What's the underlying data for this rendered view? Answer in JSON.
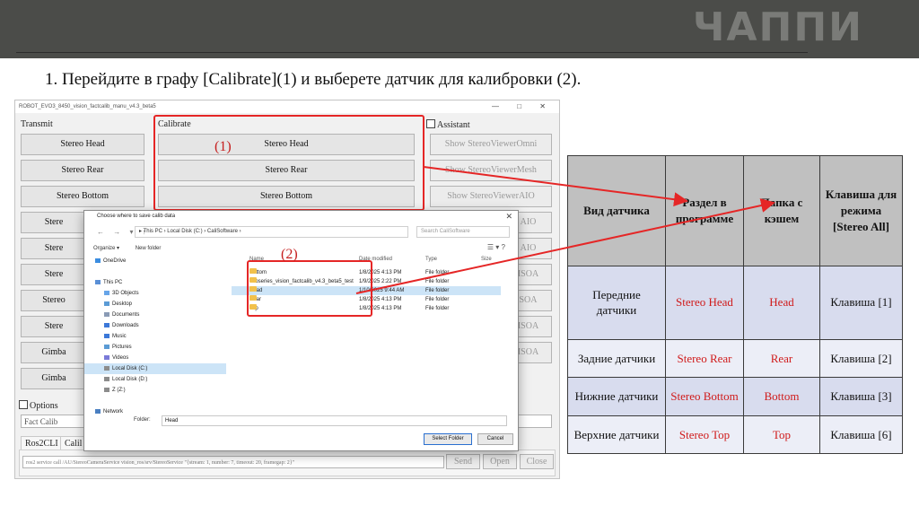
{
  "brand": {
    "logo_text": "ЧАППИ"
  },
  "instruction": "1.  Перейдите в графу [Calibrate](1) и выберете датчик для калибровки (2).",
  "markers": {
    "m1": "(1)",
    "m2": "(2)"
  },
  "app": {
    "window_title": "ROBOT_EVO3_8450_vision_factcalib_manu_v4.3_beta5",
    "window_controls": "— □ ✕",
    "sections": {
      "transmit": "Transmit",
      "calibrate": "Calibrate",
      "assistant": "Assistant",
      "options": "Options"
    },
    "transmit_buttons": [
      "Stereo Head",
      "Stereo Rear",
      "Stereo Bottom",
      "Stere",
      "Stere",
      "Stere",
      "Stereo",
      "Stere",
      "Gimba",
      "Gimba"
    ],
    "calibrate_buttons": [
      "Stereo Head",
      "Stereo Rear",
      "Stereo Bottom"
    ],
    "assistant_buttons": [
      "Show StereoViewerOmni",
      "Show StereoViewerMesh",
      "Show StereoViewerAIO",
      "AIO",
      "AIO",
      "ISOA",
      "SOA",
      "ISOA",
      "ISOA"
    ],
    "options_value": "Fact Calib",
    "tabs": [
      "Ros2CLI",
      "Calil"
    ],
    "command": "ros2 service call /AU/StereoCameraService vision_ros/srv/StereoService \"{stream: 1, number: 7, timeout: 20, framegap: 2}\"",
    "bottom_buttons": {
      "send": "Send",
      "open": "Open",
      "close": "Close"
    }
  },
  "dialog": {
    "title": "Choose where to save calib data",
    "close": "✕",
    "nav_arrows": "← → ▾ ↑",
    "address": "▸ This PC › Local Disk (C:) › CaliSoftware ›",
    "search_placeholder": "Search CaliSoftware",
    "organize": "Organize ▾",
    "new_folder": "New folder",
    "view_icons": "☰ ▾ ?",
    "nav": [
      {
        "label": "OneDrive",
        "color": "#3b8de0"
      },
      {
        "label": "",
        "color": ""
      },
      {
        "label": "This PC",
        "color": "#5a8fd6"
      },
      {
        "label": "3D Objects",
        "color": "#67a5e8"
      },
      {
        "label": "Desktop",
        "color": "#5b9bd5"
      },
      {
        "label": "Documents",
        "color": "#8a9bb5"
      },
      {
        "label": "Downloads",
        "color": "#3c78d8"
      },
      {
        "label": "Music",
        "color": "#3c78d8"
      },
      {
        "label": "Pictures",
        "color": "#5b9bd5"
      },
      {
        "label": "Videos",
        "color": "#7a7ad8"
      },
      {
        "label": "Local Disk (C:)",
        "color": "#8c8c8c",
        "selected": true
      },
      {
        "label": "Local Disk (D:)",
        "color": "#8c8c8c"
      },
      {
        "label": "Z (Z:)",
        "color": "#8c8c8c"
      },
      {
        "label": "",
        "color": ""
      },
      {
        "label": "Network",
        "color": "#4a7fc1"
      }
    ],
    "columns": {
      "name": "Name",
      "date": "Date modified",
      "type": "Type",
      "size": "Size"
    },
    "files": [
      {
        "name": "Bottom",
        "date": "1/8/2025 4:13 PM",
        "type": "File folder"
      },
      {
        "name": "evoseries_vision_factcalib_v4.3_beta5_test",
        "date": "1/9/2025 2:22 PM",
        "type": "File folder"
      },
      {
        "name": "Head",
        "date": "1/10/2025 9:44 AM",
        "type": "File folder",
        "selected": true
      },
      {
        "name": "Rear",
        "date": "1/8/2025 4:13 PM",
        "type": "File folder"
      },
      {
        "name": "Top",
        "date": "1/8/2025 4:13 PM",
        "type": "File folder"
      }
    ],
    "folder_label": "Folder:",
    "folder_value": "Head",
    "select_button": "Select Folder",
    "cancel_button": "Cancel"
  },
  "table": {
    "headers": [
      "Вид датчика",
      "Раздел в программе",
      "Папка с кэшем",
      "Клавиша для режима [Stereo All]"
    ],
    "rows": [
      [
        "Передние датчики",
        "Stereo Head",
        "Head",
        "Клавиша [1]"
      ],
      [
        "Задние датчики",
        "Stereo Rear",
        "Rear",
        "Клавиша [2]"
      ],
      [
        "Нижние датчики",
        "Stereo Bottom",
        "Bottom",
        "Клавиша [3]"
      ],
      [
        "Верхние датчики",
        "Stereo Top",
        "Top",
        "Клавиша [6]"
      ]
    ]
  },
  "colors": {
    "header_bg": "#4b4c49",
    "accent_red": "#e52626",
    "table_header": "#c0c0c0",
    "row_dark": "#d8dcee",
    "row_light": "#eceef7"
  }
}
